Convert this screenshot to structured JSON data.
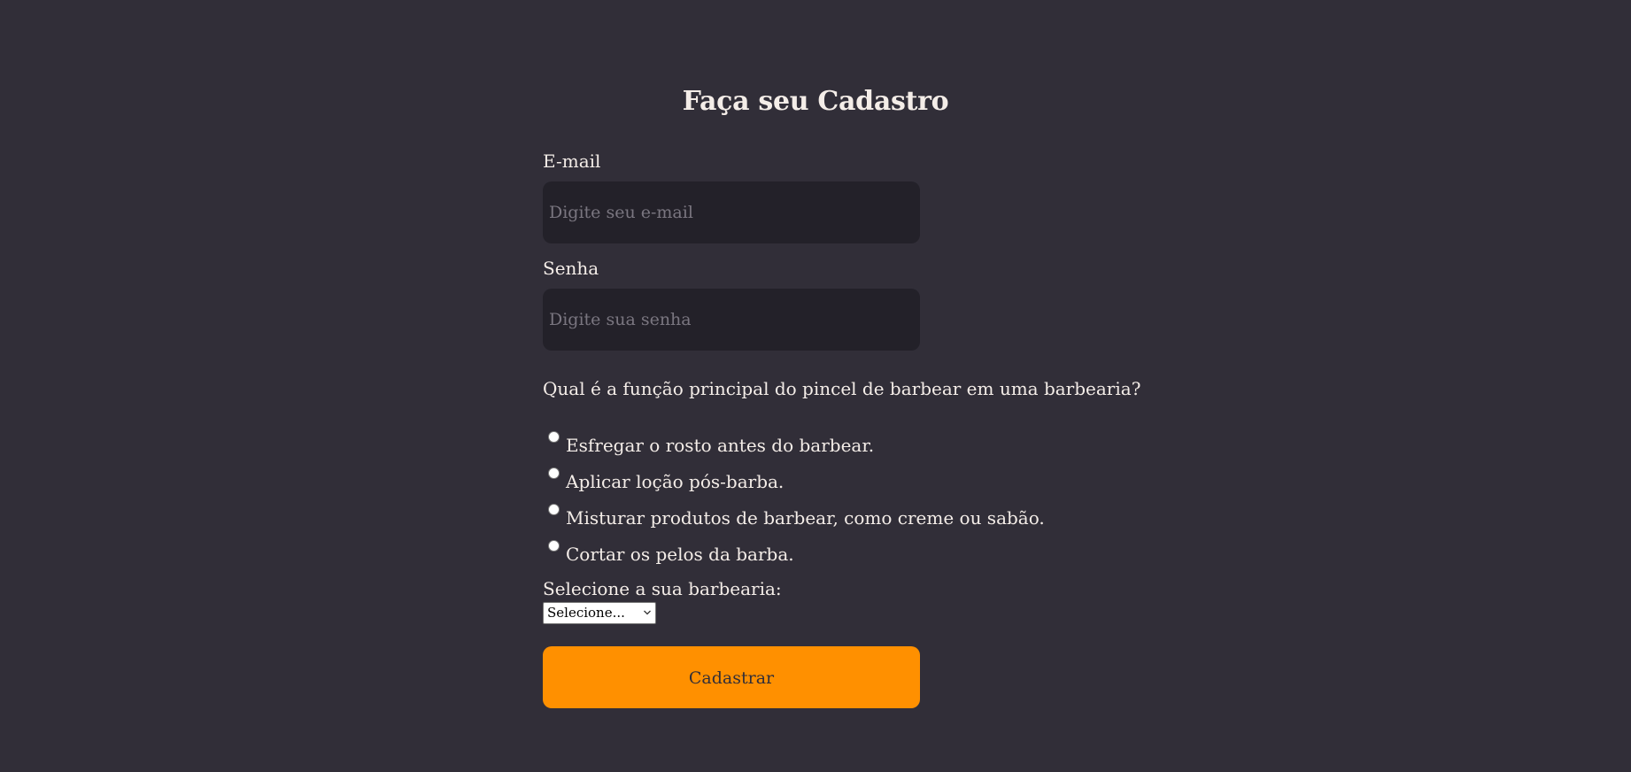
{
  "title": "Faça seu Cadastro",
  "email": {
    "label": "E-mail",
    "placeholder": "Digite seu e-mail",
    "value": ""
  },
  "password": {
    "label": "Senha",
    "placeholder": "Digite sua senha",
    "value": ""
  },
  "quiz": {
    "question": "Qual é a função principal do pincel de barbear em uma barbearia?",
    "options": [
      {
        "label": "Esfregar o rosto antes do barbear.",
        "checked": false
      },
      {
        "label": "Aplicar loção pós-barba.",
        "checked": false
      },
      {
        "label": "Misturar produtos de barbear, como creme ou sabão.",
        "checked": false
      },
      {
        "label": "Cortar os pelos da barba.",
        "checked": false
      }
    ]
  },
  "barbershop": {
    "label": "Selecione a sua barbearia:",
    "selected": "Selecione..."
  },
  "submit_label": "Cadastrar",
  "colors": {
    "background": "#312e38",
    "input_background": "#232129",
    "text": "#f4ede8",
    "placeholder": "#7a7680",
    "accent": "#ff9000"
  },
  "icons": {
    "select_arrow": "chevron-down-icon"
  }
}
